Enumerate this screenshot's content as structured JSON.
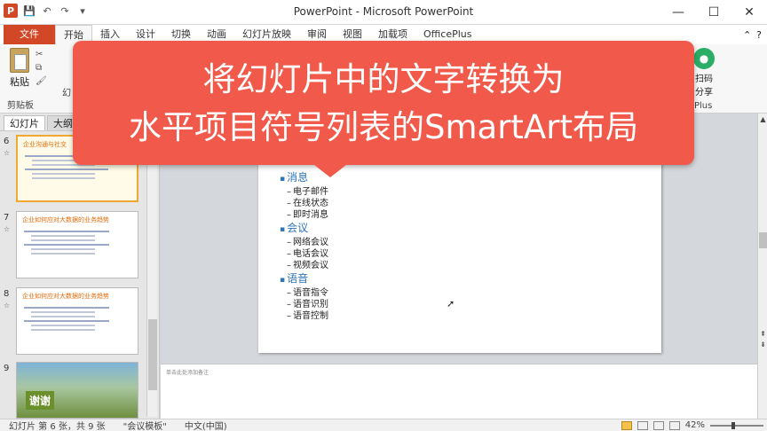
{
  "window": {
    "title": "PowerPoint - Microsoft PowerPoint",
    "app_icon_letter": "P",
    "controls": [
      "—",
      "☐",
      "✕"
    ]
  },
  "qat": {
    "save_glyph": "💾",
    "undo_glyph": "↶",
    "redo_glyph": "↷",
    "more_glyph": "▾"
  },
  "tabs": {
    "file": "文件",
    "items": [
      "开始",
      "插入",
      "设计",
      "切换",
      "动画",
      "幻灯片放映",
      "审阅",
      "视图",
      "加载项",
      "OfficePlus"
    ],
    "help_glyph": "?",
    "collapse_glyph": "⌃"
  },
  "ribbon": {
    "paste_label": "粘贴",
    "clipboard_group": "剪贴板",
    "fragment_label": "幻",
    "share_label_1": "扫码",
    "share_label_2": "分享",
    "plus_group": "Plus"
  },
  "left_pane": {
    "tabs": [
      "幻灯片",
      "大纲"
    ],
    "thumbs": [
      {
        "num": "6",
        "title": "企业沟通与社交",
        "selected": true
      },
      {
        "num": "7",
        "title": "企业如何应对大数据的业务趋势",
        "selected": false
      },
      {
        "num": "8",
        "title": "企业如何应对大数据的业务趋势",
        "selected": false
      },
      {
        "num": "9",
        "title": "",
        "thank": "谢谢",
        "selected": false
      }
    ]
  },
  "slide": {
    "bullets": [
      {
        "head": "消息",
        "items": [
          "电子邮件",
          "在线状态",
          "即时消息"
        ]
      },
      {
        "head": "会议",
        "items": [
          "网络会议",
          "电话会议",
          "视频会议"
        ]
      },
      {
        "head": "语音",
        "items": [
          "语音指令",
          "语音识别",
          "语音控制"
        ]
      }
    ]
  },
  "notes": {
    "placeholder": "单击此处添加备注"
  },
  "status": {
    "slide_info": "幻灯片 第 6 张，共 9 张",
    "theme": "\"会议模板\"",
    "language": "中文(中国)",
    "zoom": "42%"
  },
  "callout": {
    "line1": "将幻灯片中的文字转换为",
    "line2": "水平项目符号列表的SmartArt布局",
    "color": "#f15a4a"
  }
}
